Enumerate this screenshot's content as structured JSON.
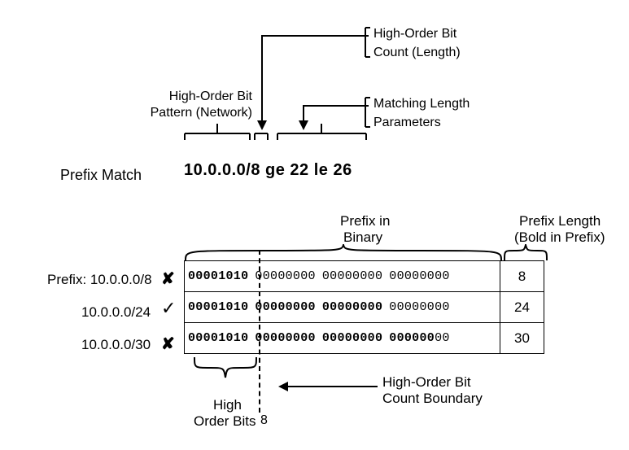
{
  "chart_data": {
    "type": "table",
    "prefix_filter": "10.0.0.0/8 ge 22 le 26",
    "filter_parts": {
      "network": "10.0.0.0",
      "length": 8,
      "ge": 22,
      "le": 26
    },
    "high_order_bit_count": 8,
    "rows": [
      {
        "label": "Prefix: 10.0.0.0/8",
        "match": false,
        "mark": "✘",
        "octets": [
          "00001010",
          "00000000",
          "00000000",
          "00000000"
        ],
        "bold_through_bit": 8,
        "length": 8
      },
      {
        "label": "10.0.0.0/24",
        "match": true,
        "mark": "✓",
        "octets": [
          "00001010",
          "00000000",
          "00000000",
          "00000000"
        ],
        "bold_through_bit": 24,
        "length": 24
      },
      {
        "label": "10.0.0.0/30",
        "match": false,
        "mark": "✘",
        "octets": [
          "00001010",
          "00000000",
          "00000000",
          "00000000"
        ],
        "bold_through_bit": 30,
        "length": 30
      }
    ]
  },
  "labels": {
    "prefix_match": "Prefix Match",
    "expr": "10.0.0.0/8 ge 22 le 26",
    "high_order_bit_pattern_l1": "High-Order Bit",
    "high_order_bit_pattern_l2": "Pattern (Network)",
    "callout_len_l1": "High-Order Bit",
    "callout_len_l2": "Count (Length)",
    "callout_params_l1": "Matching Length",
    "callout_params_l2": "Parameters",
    "header_prefix_binary_l1": "Prefix in",
    "header_prefix_binary_l2": "Binary",
    "header_prefix_len_l1": "Prefix Length",
    "header_prefix_len_l2": "(Bold in Prefix)",
    "bottom_hob_l1": "High",
    "bottom_hob_l2": "Order Bits",
    "bottom_hob_count": "8",
    "bottom_boundary_l1": "High-Order Bit",
    "bottom_boundary_l2": "Count Boundary"
  },
  "row_labels": {
    "r1": "Prefix: 10.0.0.0/8",
    "r2": "10.0.0.0/24",
    "r3": "10.0.0.0/30"
  },
  "lengths": {
    "r1": "8",
    "r2": "24",
    "r3": "30"
  },
  "marks": {
    "r1": "✘",
    "r2": "✓",
    "r3": "✘"
  }
}
